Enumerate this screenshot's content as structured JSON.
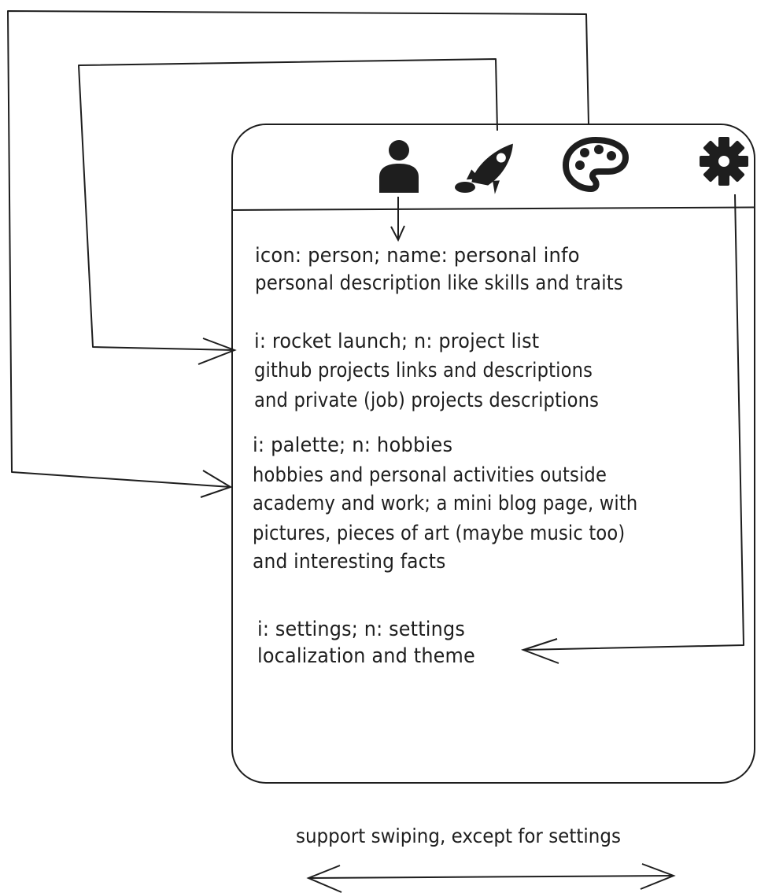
{
  "tabs": [
    {
      "icon": "person-icon"
    },
    {
      "icon": "rocket-launch-icon"
    },
    {
      "icon": "palette-icon"
    },
    {
      "icon": "settings-icon"
    }
  ],
  "sections": {
    "personal": {
      "line1": "icon: person; name: personal info",
      "line2": "personal description like skills and traits"
    },
    "projects": {
      "line1": "i: rocket launch; n: project list",
      "line2": "github projects links and descriptions",
      "line3": "and private (job) projects descriptions"
    },
    "hobbies": {
      "line1": "i: palette; n: hobbies",
      "line2": "hobbies and personal activities outside",
      "line3": "academy and work; a mini blog page, with",
      "line4": "pictures, pieces of art (maybe music too)",
      "line5": "and interesting facts"
    },
    "settings": {
      "line1": "i: settings; n: settings",
      "line2": "localization and theme"
    }
  },
  "footer": {
    "swipe_note": "support swiping, except for settings"
  },
  "colors": {
    "ink": "#1e1e1e",
    "background": "#ffffff"
  }
}
